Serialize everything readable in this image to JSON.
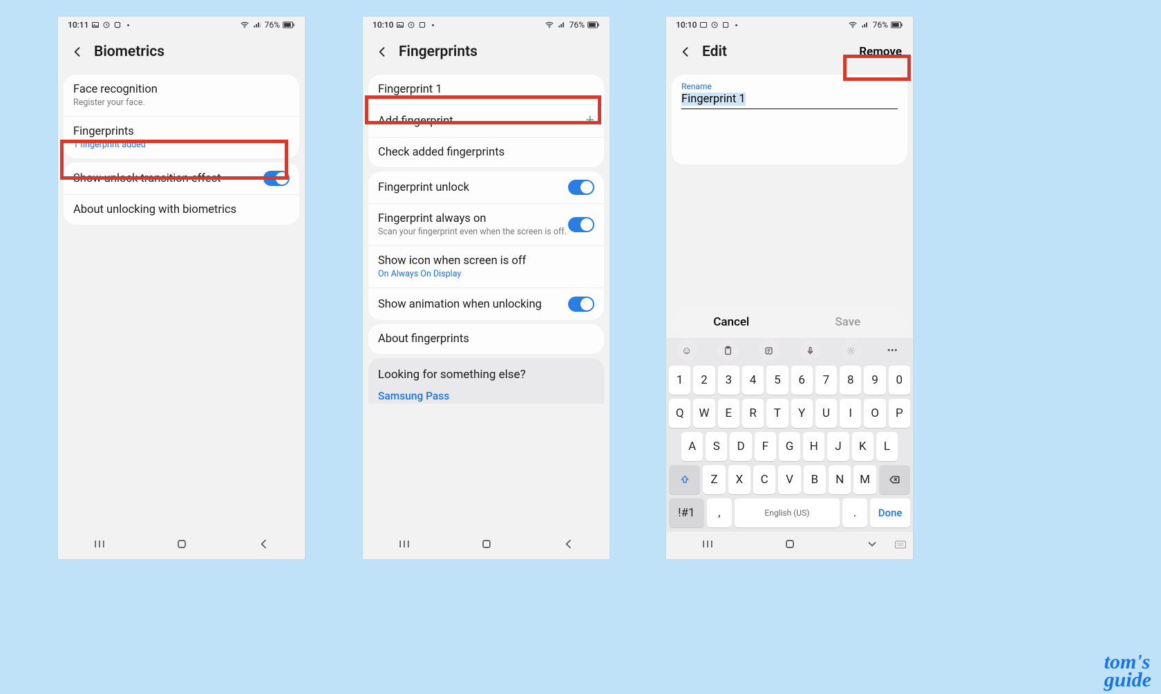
{
  "status": {
    "time1": "10:11",
    "time2": "10:10",
    "time3": "10:10",
    "battery": "76%"
  },
  "p1": {
    "title": "Biometrics",
    "face_title": "Face recognition",
    "face_sub": "Register your face.",
    "fp_title": "Fingerprints",
    "fp_sub": "1 fingerprint added",
    "transition": "Show unlock transition effect",
    "about": "About unlocking with biometrics"
  },
  "p2": {
    "title": "Fingerprints",
    "item1": "Fingerprint 1",
    "add": "Add fingerprint",
    "check": "Check added fingerprints",
    "unlock": "Fingerprint unlock",
    "always_title": "Fingerprint always on",
    "always_sub": "Scan your fingerprint even when the screen is off.",
    "showicon_title": "Show icon when screen is off",
    "showicon_sub": "On Always On Display",
    "anim": "Show animation when unlocking",
    "about": "About fingerprints",
    "footer_q": "Looking for something else?",
    "footer_link": "Samsung Pass"
  },
  "p3": {
    "title": "Edit",
    "remove": "Remove",
    "label": "Rename",
    "value": "Fingerprint 1",
    "cancel": "Cancel",
    "save": "Save",
    "space_label": "English (US)",
    "done": "Done",
    "sym": "!#1"
  },
  "kb": {
    "r1": [
      "1",
      "2",
      "3",
      "4",
      "5",
      "6",
      "7",
      "8",
      "9",
      "0"
    ],
    "r2": [
      "Q",
      "W",
      "E",
      "R",
      "T",
      "Y",
      "U",
      "I",
      "O",
      "P"
    ],
    "r3": [
      "A",
      "S",
      "D",
      "F",
      "G",
      "H",
      "J",
      "K",
      "L"
    ],
    "r4": [
      "Z",
      "X",
      "C",
      "V",
      "B",
      "N",
      "M"
    ]
  },
  "brand": {
    "l1": "tom's",
    "l2": "guide"
  }
}
